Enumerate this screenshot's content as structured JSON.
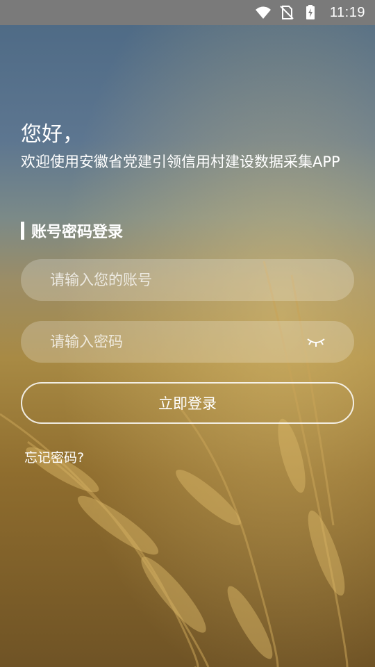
{
  "status_bar": {
    "time": "11:19"
  },
  "greeting": "您好，",
  "welcome_text": "欢迎使用安徽省党建引领信用村建设数据采集APP",
  "section_title": "账号密码登录",
  "account_input": {
    "value": "",
    "placeholder": "请输入您的账号"
  },
  "password_input": {
    "value": "",
    "placeholder": "请输入密码"
  },
  "login_button_label": "立即登录",
  "forgot_password_label": "忘记密码?",
  "icons": [
    "wifi-icon",
    "no-sim-icon",
    "battery-charging-icon",
    "eye-closed-icon"
  ]
}
